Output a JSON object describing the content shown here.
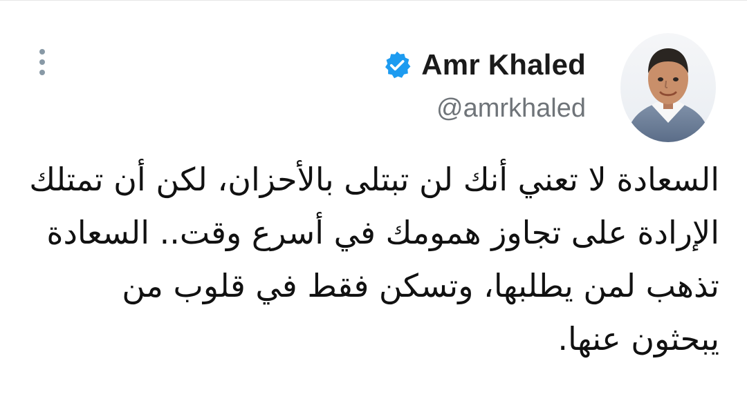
{
  "tweet": {
    "author": {
      "display_name": "Amr Khaled",
      "handle": "@amrkhaled",
      "verified_icon": "verified-badge-icon",
      "avatar_icon": "user-avatar-icon"
    },
    "body_text": "السعادة لا تعني أنك لن تبتلى بالأحزان، لكن أن تمتلك الإرادة على تجاوز همومك في أسرع وقت.. السعادة تذهب لمن يطلبها، وتسكن فقط في قلوب من يبحثون عنها."
  },
  "ui": {
    "more_icon": "more-options-icon"
  },
  "colors": {
    "verified_blue": "#1d9bf0",
    "name_text": "#1a1a1a",
    "handle_text": "#6f7479",
    "body_text": "#111111",
    "more_icon": "#8899a6"
  }
}
